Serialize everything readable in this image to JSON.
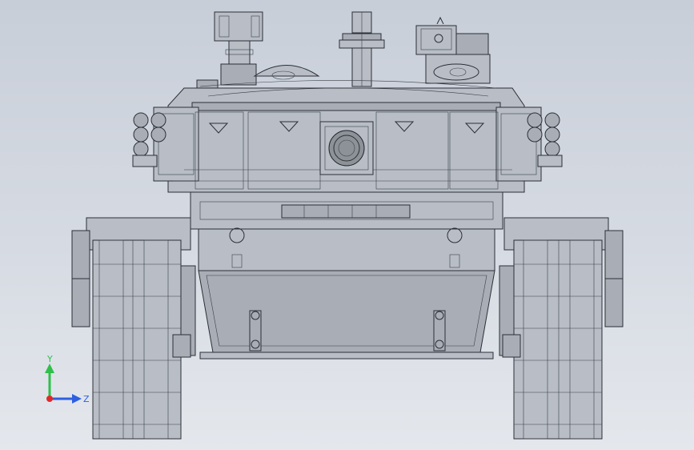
{
  "triad": {
    "y_label": "Y",
    "z_label": "Z",
    "colors": {
      "y_axis": "#2fbf4a",
      "z_axis": "#2e5fe0",
      "x_origin": "#e02a2a"
    }
  },
  "colors": {
    "background_top": "#c8ced8",
    "background_bottom": "#e4e7ec",
    "wire": "#2b2f36",
    "body_fill": "#b9bec6"
  }
}
